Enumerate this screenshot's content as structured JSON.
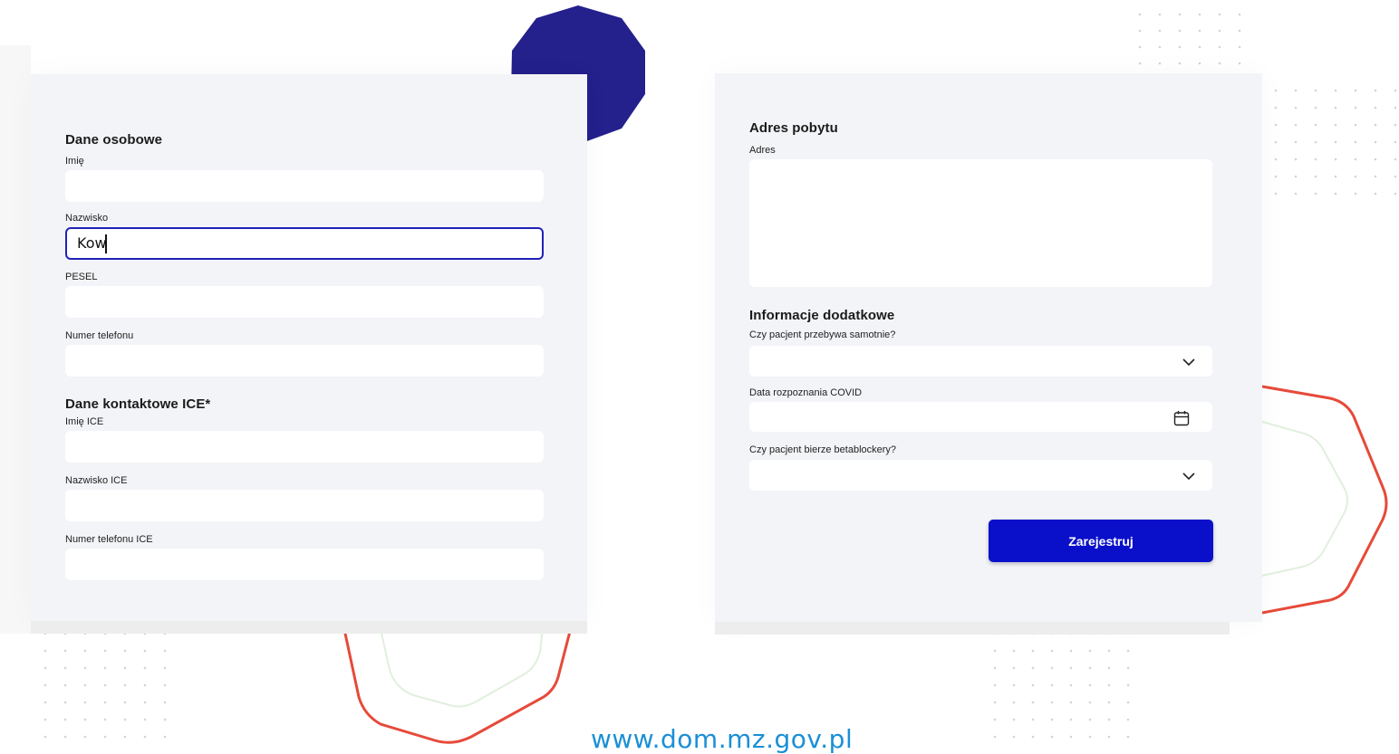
{
  "left_form": {
    "personal": {
      "title": "Dane osobowe",
      "first_name_label": "Imię",
      "first_name_value": "",
      "last_name_label": "Nazwisko",
      "last_name_value": "Kow",
      "pesel_label": "PESEL",
      "pesel_value": "",
      "phone_label": "Numer telefonu",
      "phone_value": ""
    },
    "ice": {
      "title": "Dane kontaktowe ICE*",
      "first_name_label": "Imię ICE",
      "first_name_value": "",
      "last_name_label": "Nazwisko ICE",
      "last_name_value": "",
      "phone_label": "Numer telefonu ICE",
      "phone_value": ""
    }
  },
  "right_form": {
    "address": {
      "title": "Adres pobytu",
      "address_label": "Adres",
      "address_value": ""
    },
    "extra": {
      "title": "Informacje dodatkowe",
      "alone_label": "Czy pacjent przebywa samotnie?",
      "alone_value": "",
      "alone_icon": "chevron-down-icon",
      "covid_label": "Data rozpoznania COVID",
      "covid_value": "",
      "covid_icon": "calendar-icon",
      "beta_label": "Czy pacjent bierze betablockery?",
      "beta_value": "",
      "beta_icon": "chevron-down-icon"
    },
    "submit_label": "Zarejestruj"
  },
  "footer": {
    "url": "www.dom.mz.gov.pl"
  },
  "colors": {
    "accent": "#0a10c9",
    "focus_border": "#1f22b8",
    "decagon": "#24208c",
    "outline_red": "#e64a3a",
    "outline_green": "#d6ecd4",
    "url_blue": "#1a8fd6",
    "card_bg": "#f3f4f7"
  }
}
